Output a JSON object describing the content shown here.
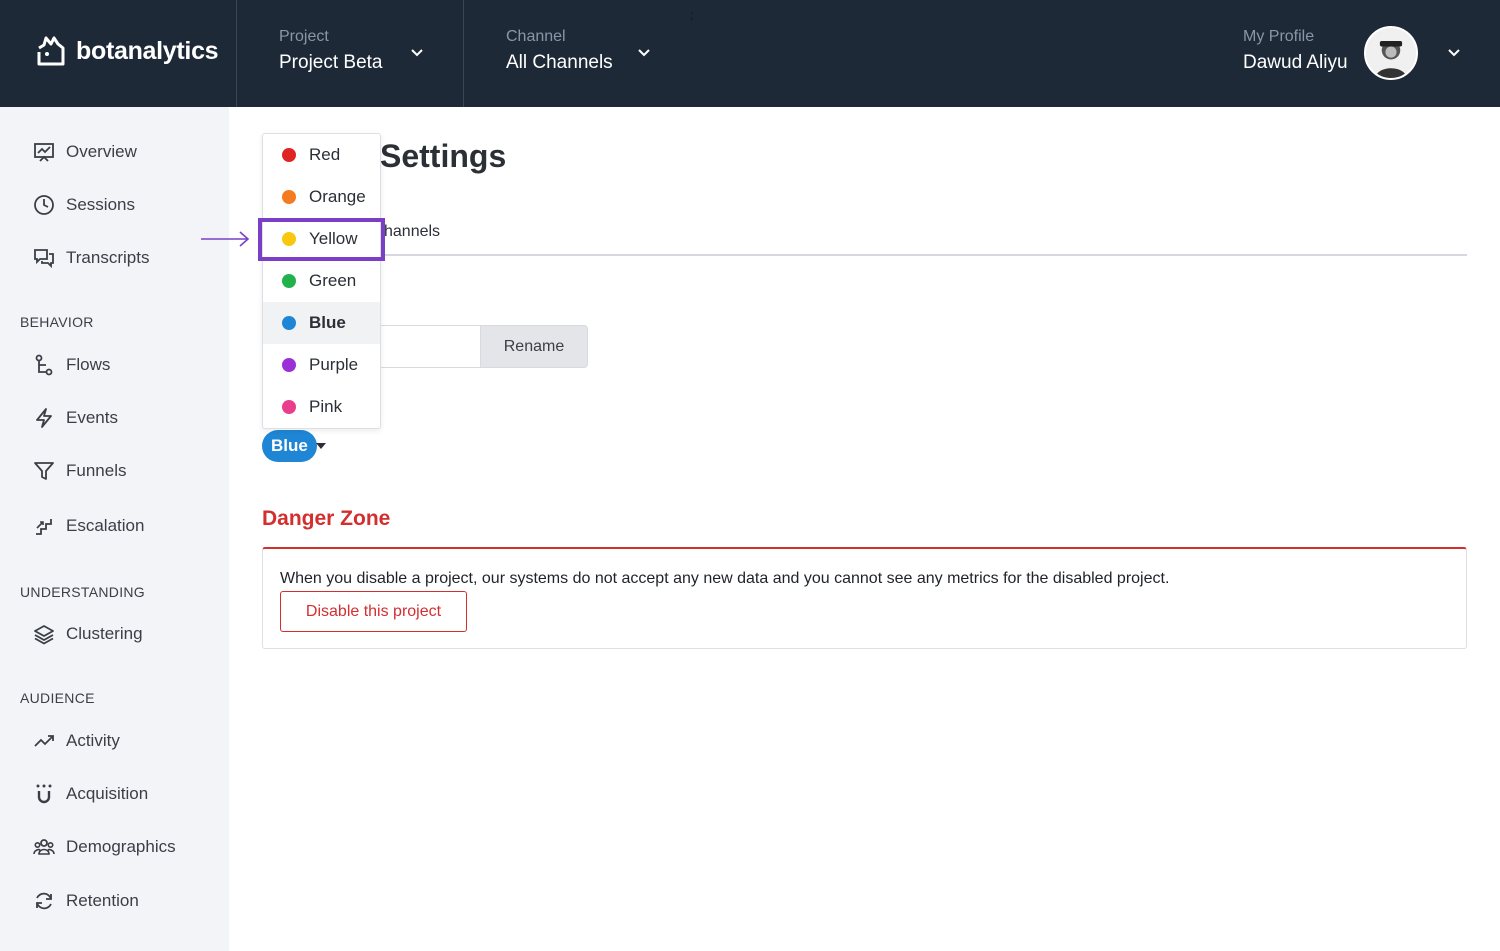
{
  "header": {
    "brand": "botanalytics",
    "project": {
      "label": "Project",
      "value": "Project Beta"
    },
    "channel": {
      "label": "Channel",
      "value": "All Channels"
    },
    "profile": {
      "label": "My Profile",
      "value": "Dawud Aliyu"
    },
    "stray_mark": ";"
  },
  "sidebar": {
    "items": [
      {
        "label": "Overview",
        "icon": "overview-icon"
      },
      {
        "label": "Sessions",
        "icon": "clock-icon"
      },
      {
        "label": "Transcripts",
        "icon": "chat-icon"
      }
    ],
    "behavior": {
      "title": "BEHAVIOR",
      "items": [
        {
          "label": "Flows",
          "icon": "flows-icon"
        },
        {
          "label": "Events",
          "icon": "bolt-icon"
        },
        {
          "label": "Funnels",
          "icon": "funnel-icon"
        },
        {
          "label": "Escalation",
          "icon": "stairs-icon"
        }
      ]
    },
    "understanding": {
      "title": "UNDERSTANDING",
      "items": [
        {
          "label": "Clustering",
          "icon": "layers-icon"
        }
      ]
    },
    "audience": {
      "title": "AUDIENCE",
      "items": [
        {
          "label": "Activity",
          "icon": "trend-icon"
        },
        {
          "label": "Acquisition",
          "icon": "magnet-icon"
        },
        {
          "label": "Demographics",
          "icon": "group-icon"
        },
        {
          "label": "Retention",
          "icon": "refresh-icon"
        }
      ]
    }
  },
  "main": {
    "title_partial": "Settings",
    "tab_partial": "hannels",
    "rename_label": "Rename",
    "selected_color": "Blue",
    "danger": {
      "title": "Danger Zone",
      "text": "When you disable a project, our systems do not accept any new data and you cannot see any metrics for the disabled project.",
      "button": "Disable this project"
    }
  },
  "color_menu": {
    "options": [
      {
        "label": "Red",
        "color": "#e02424"
      },
      {
        "label": "Orange",
        "color": "#f47b20"
      },
      {
        "label": "Yellow",
        "color": "#f9c80e"
      },
      {
        "label": "Green",
        "color": "#22b24c"
      },
      {
        "label": "Blue",
        "color": "#1f86d6"
      },
      {
        "label": "Purple",
        "color": "#9b30d9"
      },
      {
        "label": "Pink",
        "color": "#e83e8c"
      }
    ]
  },
  "colors": {
    "header_bg": "#1e2938",
    "sidebar_bg": "#f3f4f7",
    "accent_blue": "#1f86d6",
    "danger_red": "#d32f2f",
    "highlight_purple": "#7b3fc6"
  }
}
